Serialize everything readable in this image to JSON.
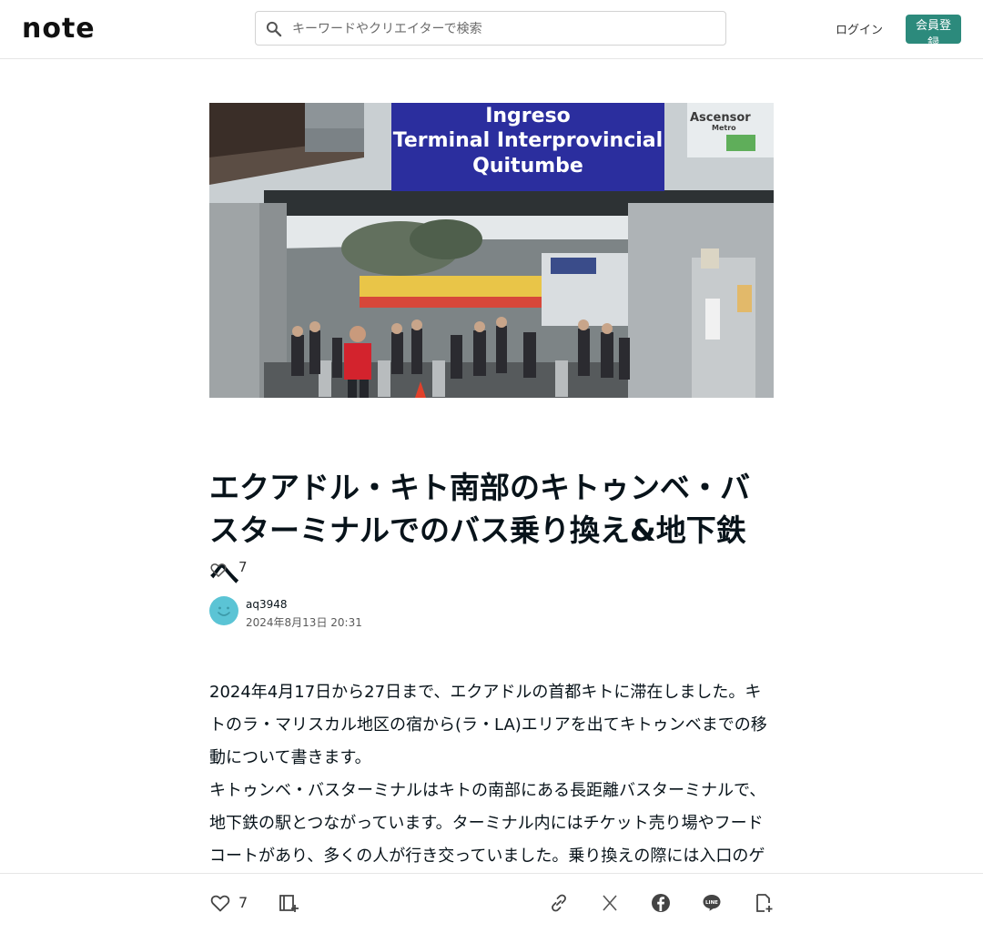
{
  "header": {
    "logo_text": "note",
    "search_placeholder": "キーワードやクリエイターで検索",
    "login_label": "ログイン",
    "signup_label": "会員登録"
  },
  "hero": {
    "sign_main_line1": "Ingreso",
    "sign_main_line2": "Terminal Interprovincial",
    "sign_main_line3": "Quitumbe",
    "sign_right_line1": "Ascensor",
    "sign_right_line2": "Metro"
  },
  "article": {
    "title": "エクアドル・キト南部のキトゥンベ・バスターミナルでのバス乗り換え&地下鉄へ",
    "likes": "7",
    "author": "aq3948",
    "date": "2024年8月13日 20:31",
    "paragraph1": "2024年4月17日から27日まで、エクアドルの首都キトに滞在しました。キトのラ・マリスカル地区の宿から(ラ・LA)エリアを出てキトゥンベまでの移動について書きます。",
    "paragraph2": "キトゥンベ・バスターミナルはキトの南部にある長距離バスターミナルで、地下鉄の駅とつながっています。ターミナル内にはチケット売り場やフードコートがあり、多くの人が行き交っていました。乗り換えの際には入口のゲートを通る必要があります。"
  },
  "footer_bar": {
    "like_count": "7"
  },
  "colors": {
    "brand_green": "#2c8a7c",
    "sign_blue": "#2b2e9e",
    "avatar_blue": "#5bc4d5"
  }
}
